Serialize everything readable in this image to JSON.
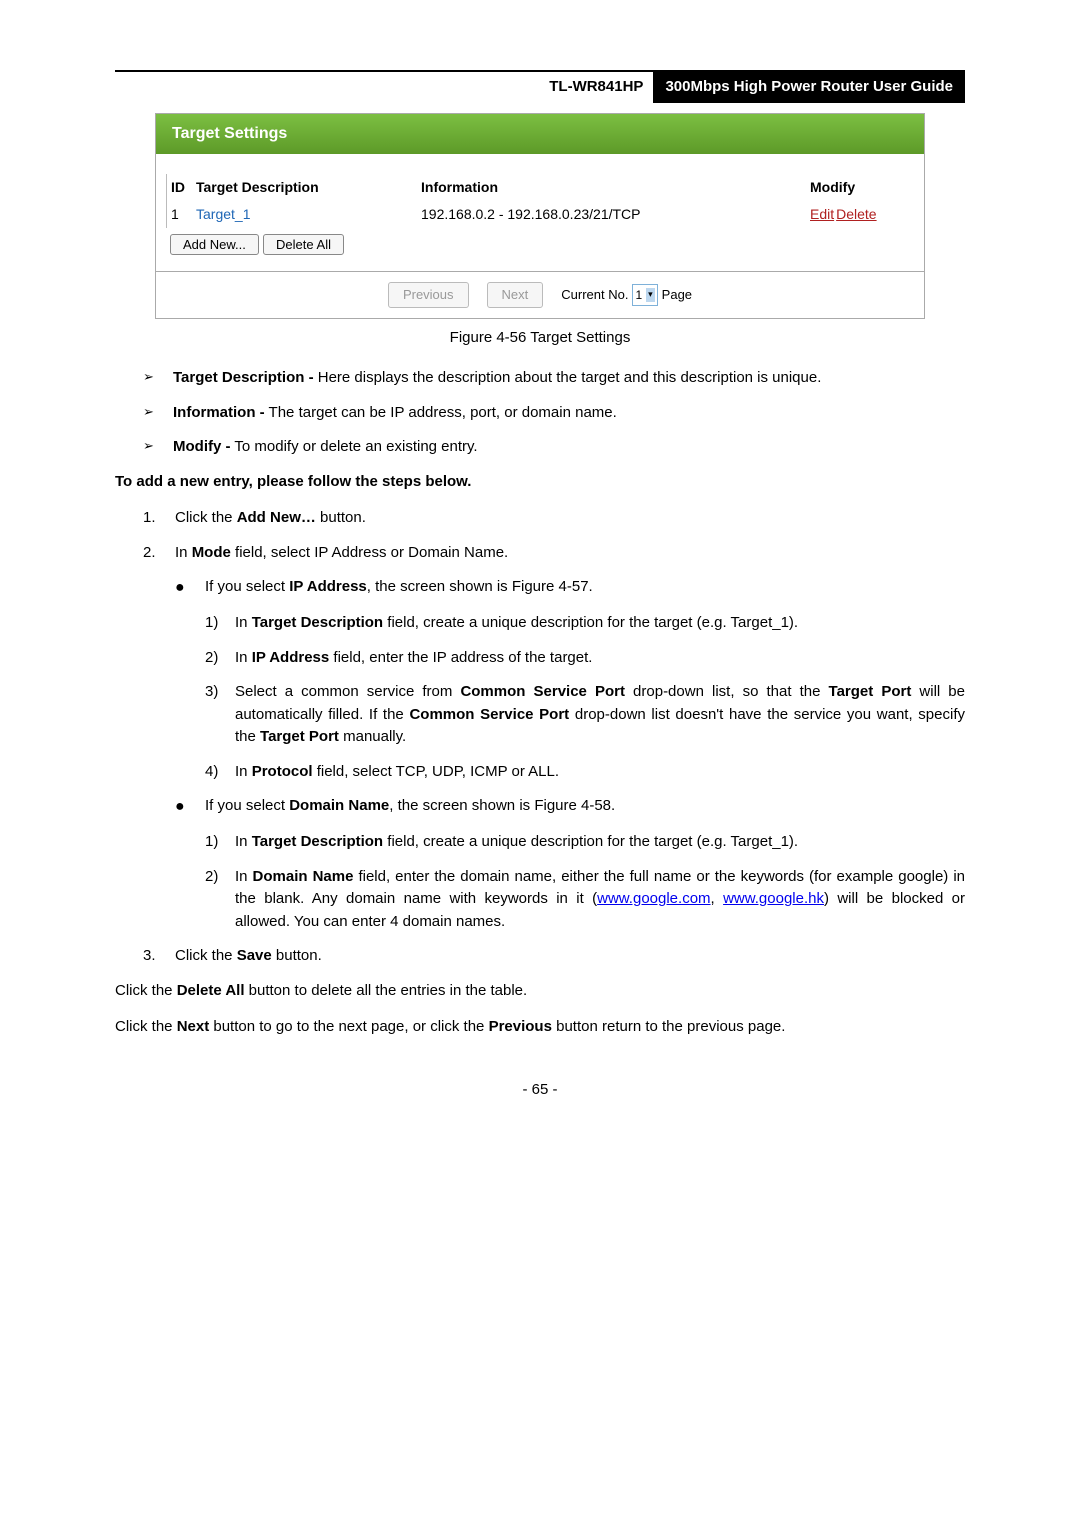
{
  "header": {
    "model": "TL-WR841HP",
    "title": "300Mbps High Power Router User Guide"
  },
  "figure": {
    "panelTitle": "Target Settings",
    "cols": {
      "id": "ID",
      "desc": "Target Description",
      "info": "Information",
      "mod": "Modify"
    },
    "row": {
      "id": "1",
      "desc": "Target_1",
      "info": "192.168.0.2 - 192.168.0.23/21/TCP",
      "edit": "Edit",
      "del": "Delete"
    },
    "addNew": "Add New...",
    "deleteAll": "Delete All",
    "previous": "Previous",
    "next": "Next",
    "currentNo": "Current No.",
    "pageNum": "1",
    "pageLabel": "Page",
    "caption": "Figure 4-56    Target Settings"
  },
  "bullets": {
    "b1": {
      "label": "Target Description -",
      "text": " Here displays the description about the target and this description is unique."
    },
    "b2": {
      "label": "Information -",
      "text": " The target can be IP address, port, or domain name."
    },
    "b3": {
      "label": "Modify -",
      "text": " To modify or delete an existing entry."
    }
  },
  "stepsHeading": "To add a new entry, please follow the steps below.",
  "step1": {
    "pre": "Click the ",
    "bold": "Add New…",
    "post": " button."
  },
  "step2": {
    "pre": "In ",
    "bold": "Mode",
    "post": " field, select IP Address or Domain Name."
  },
  "sub1": {
    "pre": "If you select ",
    "bold": "IP Address",
    "post": ", the screen shown is Figure 4-57."
  },
  "s1_1": {
    "a": "In ",
    "b": "Target Description",
    "c": " field, create a unique description for the target (e.g. Target_1)."
  },
  "s1_2": {
    "a": "In ",
    "b": "IP Address",
    "c": " field, enter the IP address of the target."
  },
  "s1_3": {
    "a": "Select a common service from ",
    "b": "Common Service Port",
    "c": " drop-down list, so that the ",
    "d": "Target Port",
    "e": " will be automatically filled. If the ",
    "f": "Common Service Port",
    "g": " drop-down list doesn't have the service you want, specify the ",
    "h": "Target Port",
    "i": " manually."
  },
  "s1_4": {
    "a": "In ",
    "b": "Protocol",
    "c": " field, select TCP, UDP, ICMP or ALL."
  },
  "sub2": {
    "pre": "If you select ",
    "bold": "Domain Name",
    "post": ", the screen shown is Figure 4-58."
  },
  "s2_1": {
    "a": "In ",
    "b": "Target Description",
    "c": " field, create a unique description for the target (e.g. Target_1)."
  },
  "s2_2": {
    "a": "In ",
    "b": "Domain Name",
    "c": " field, enter the domain name, either the full name or the keywords (for example google) in the blank. Any domain name with keywords in it (",
    "l1": "www.google.com",
    "m": ", ",
    "l2": "www.google.hk",
    "d": ") will be blocked or allowed. You can enter 4 domain names."
  },
  "step3": {
    "pre": "Click the ",
    "bold": "Save",
    "post": " button."
  },
  "p1": {
    "a": "Click the ",
    "b": "Delete All",
    "c": " button to delete all the entries in the table."
  },
  "p2": {
    "a": "Click the ",
    "b": "Next",
    "c": " button to go to the next page, or click the ",
    "d": "Previous",
    "e": " button return to the previous page."
  },
  "pageNumber": "- 65 -"
}
